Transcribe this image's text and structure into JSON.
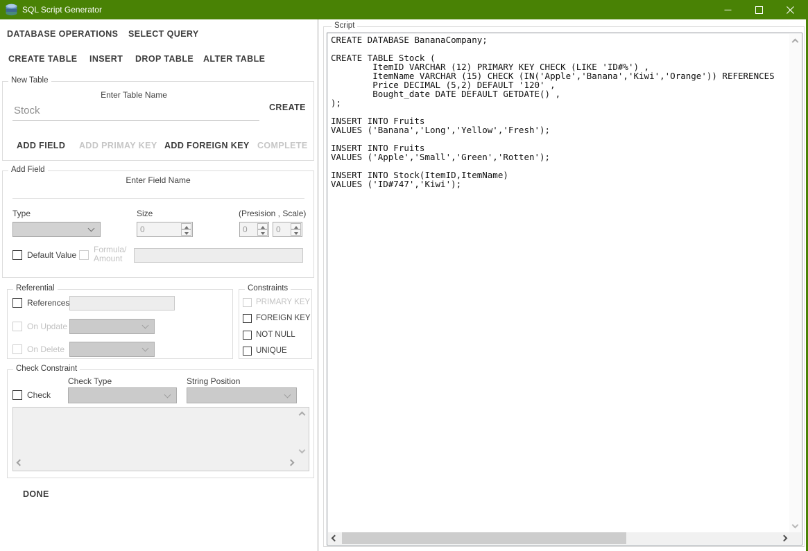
{
  "colors": {
    "titlebar": "#498205",
    "disabled_text": "#c2c2c2",
    "text": "#3c3c3c"
  },
  "icons": {
    "app": "database-cylinder",
    "minimize": "–",
    "maximize": "□",
    "close": "✕",
    "dropdown": "⌄",
    "spinner_up": "▲",
    "spinner_down": "▼",
    "scroll_up": "∧",
    "scroll_down": "∨",
    "scroll_left": "‹",
    "scroll_right": "›"
  },
  "titlebar": {
    "title": "SQL Script Generator"
  },
  "menu": {
    "primary": [
      {
        "label": "DATABASE OPERATIONS"
      },
      {
        "label": "SELECT QUERY"
      }
    ],
    "secondary": [
      {
        "label": "CREATE TABLE"
      },
      {
        "label": "INSERT"
      },
      {
        "label": "DROP TABLE"
      },
      {
        "label": "ALTER TABLE"
      }
    ]
  },
  "new_table": {
    "group_label": "New Table",
    "name_label": "Enter Table Name",
    "name_value": "Stock",
    "create_label": "CREATE",
    "actions": [
      {
        "label": "ADD FIELD",
        "enabled": true
      },
      {
        "label": "ADD PRIMAY KEY",
        "enabled": false
      },
      {
        "label": "ADD FOREIGN KEY",
        "enabled": true
      },
      {
        "label": "COMPLETE",
        "enabled": false
      }
    ]
  },
  "add_field": {
    "group_label": "Add Field",
    "field_name_label": "Enter Field Name",
    "field_name_value": "",
    "type_label": "Type",
    "size_label": "Size",
    "size_value": "0",
    "precision_scale_label": "(Presision , Scale)",
    "precision_value": "0",
    "scale_value": "0",
    "default_value_label": "Default Value",
    "formula_label_line1": "Formula/",
    "formula_label_line2": "Amount",
    "formula_value": ""
  },
  "referential": {
    "group_label": "Referential",
    "references_label": "References",
    "references_value": "",
    "on_update_label": "On Update",
    "on_delete_label": "On Delete"
  },
  "constraints": {
    "group_label": "Constraints",
    "items": [
      {
        "label": "PRIMARY KEY",
        "enabled": false
      },
      {
        "label": "FOREIGN KEY",
        "enabled": true
      },
      {
        "label": "NOT NULL",
        "enabled": true
      },
      {
        "label": "UNIQUE",
        "enabled": true
      }
    ]
  },
  "check_constraint": {
    "group_label": "Check Constraint",
    "check_label": "Check",
    "check_type_label": "Check Type",
    "string_position_label": "String Position",
    "check_text_value": ""
  },
  "done_label": "DONE",
  "script": {
    "group_label": "Script",
    "lines": [
      "CREATE DATABASE BananaCompany;",
      "",
      "CREATE TABLE Stock (",
      "        ItemID VARCHAR (12) PRIMARY KEY CHECK (LIKE 'ID#%') ,",
      "        ItemName VARCHAR (15) CHECK (IN('Apple','Banana','Kiwi','Orange')) REFERENCES",
      "        Price DECIMAL (5,2) DEFAULT '120' ,",
      "        Bought_date DATE DEFAULT GETDATE() ,",
      ");",
      "",
      "INSERT INTO Fruits",
      "VALUES ('Banana','Long','Yellow','Fresh');",
      "",
      "INSERT INTO Fruits",
      "VALUES ('Apple','Small','Green','Rotten');",
      "",
      "INSERT INTO Stock(ItemID,ItemName)",
      "VALUES ('ID#747','Kiwi');"
    ]
  }
}
